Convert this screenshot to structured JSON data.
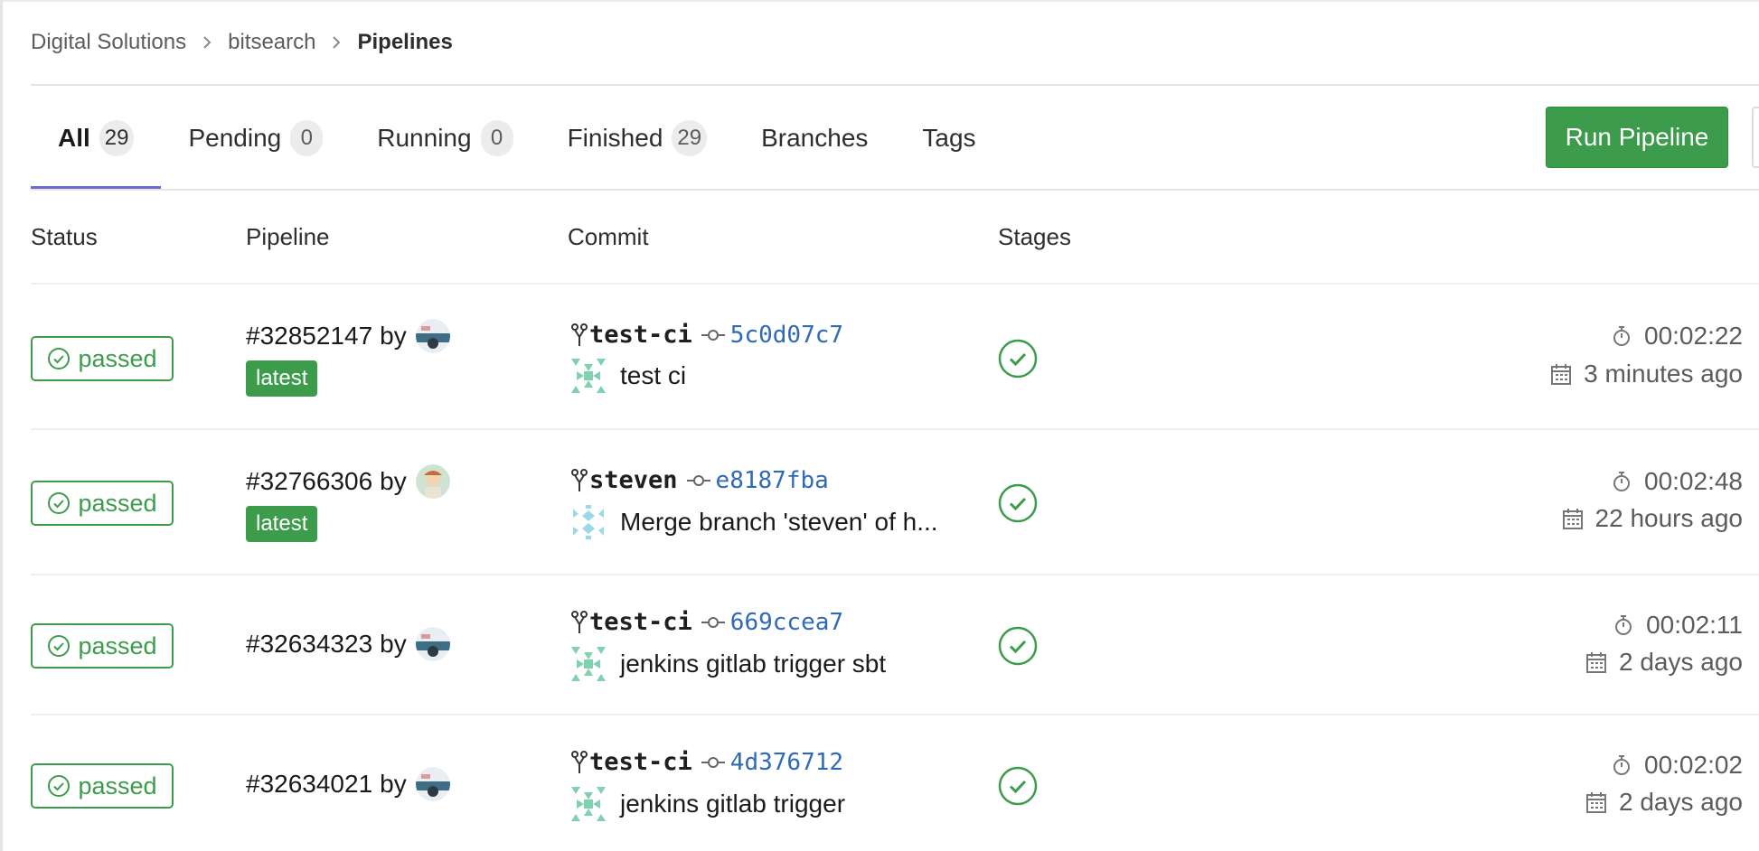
{
  "breadcrumb": {
    "items": [
      "Digital Solutions",
      "bitsearch"
    ],
    "current": "Pipelines"
  },
  "tabs": [
    {
      "label": "All",
      "count": "29",
      "active": true
    },
    {
      "label": "Pending",
      "count": "0"
    },
    {
      "label": "Running",
      "count": "0"
    },
    {
      "label": "Finished",
      "count": "29"
    },
    {
      "label": "Branches"
    },
    {
      "label": "Tags"
    }
  ],
  "actions": {
    "run_pipeline": "Run Pipeline"
  },
  "columns": {
    "status": "Status",
    "pipeline": "Pipeline",
    "commit": "Commit",
    "stages": "Stages"
  },
  "colors": {
    "success": "#3c9c4c",
    "link": "#2f6ab7",
    "active_tab": "#6b6bd0"
  },
  "pipelines": [
    {
      "status": "passed",
      "id": "#32852147",
      "by": "by",
      "latest": "latest",
      "branch": "test-ci",
      "sha": "5c0d07c7",
      "message": "test ci",
      "duration": "00:02:22",
      "ago": "3 minutes ago"
    },
    {
      "status": "passed",
      "id": "#32766306",
      "by": "by",
      "latest": "latest",
      "branch": "steven",
      "sha": "e8187fba",
      "message": "Merge branch 'steven' of h...",
      "duration": "00:02:48",
      "ago": "22 hours ago"
    },
    {
      "status": "passed",
      "id": "#32634323",
      "by": "by",
      "branch": "test-ci",
      "sha": "669ccea7",
      "message": "jenkins gitlab trigger sbt",
      "duration": "00:02:11",
      "ago": "2 days ago"
    },
    {
      "status": "passed",
      "id": "#32634021",
      "by": "by",
      "branch": "test-ci",
      "sha": "4d376712",
      "message": "jenkins gitlab trigger",
      "duration": "00:02:02",
      "ago": "2 days ago"
    }
  ]
}
